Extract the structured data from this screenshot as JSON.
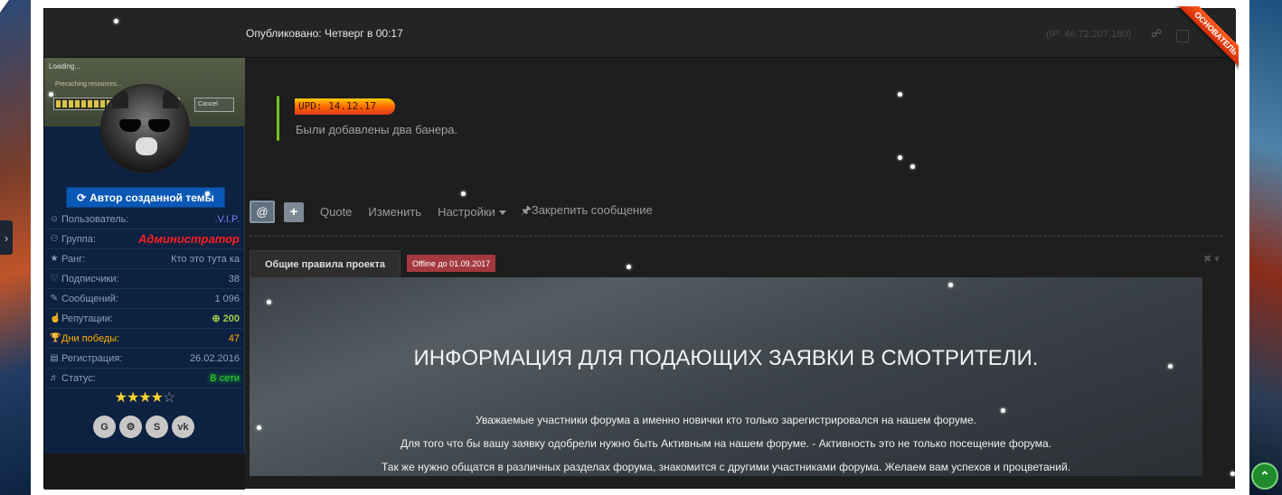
{
  "post": {
    "published": "Опубликовано: Четверг в 00:17",
    "ip": "(IP: 46.72.207.180)",
    "ribbon": "ОСНОВАТЕЛЬ"
  },
  "avatar_overlay": {
    "loading": "Loading...",
    "precaching": "Precaching resources...",
    "cancel": "Cancel"
  },
  "author": {
    "badge_label": "Автор созданной темы",
    "fields": [
      {
        "label": "Пользователь:",
        "value": ".V.I.P.",
        "icon": "user-icon"
      },
      {
        "label": "Группа:",
        "value": "Администратор",
        "icon": "group-icon"
      },
      {
        "label": "Ранг:",
        "value": "Кто это тута ка",
        "icon": "star-icon"
      },
      {
        "label": "Подписчики:",
        "value": "38",
        "icon": "heart-icon"
      },
      {
        "label": "Сообщений:",
        "value": "1 096",
        "icon": "edit-icon"
      },
      {
        "label": "Репутации:",
        "value": "200",
        "icon": "thumbs-up-icon"
      },
      {
        "label": "Дни победы:",
        "value": "47",
        "icon": "trophy-icon"
      },
      {
        "label": "Регистрация:",
        "value": "26.02.2016",
        "icon": "calendar-icon"
      },
      {
        "label": "Статус:",
        "value": "В сети",
        "icon": "bell-icon"
      }
    ],
    "rating": {
      "filled": 4,
      "total": 5
    },
    "socials": [
      "google-icon",
      "steam-icon",
      "skype-icon",
      "vk-icon"
    ]
  },
  "update": {
    "badge": "UPD: 14.12.17",
    "text": "Были добавлены два банера."
  },
  "actions": {
    "mention": "@",
    "plus": "+",
    "quote": "Quote",
    "edit": "Изменить",
    "settings": "Настройки",
    "pin": "Закрепить сообщение"
  },
  "signature": {
    "tab": "Общие правила проекта",
    "offline": "Offline до 01.09.2017",
    "heading": "ИНФОРМАЦИЯ ДЛЯ ПОДАЮЩИХ ЗАЯВКИ В СМОТРИТЕЛИ.",
    "lines": [
      "Уважаемые участники форума а именно новички кто только зарегистрировался на нашем форуме.",
      "Для того что бы вашу заявку одобрели нужно быть Активным на нашем форуме. - Активность это не только посещение форума.",
      "Так же нужно общатся в различных разделах форума, знакомится с другими участниками форума. Желаем вам успехов и процветаний."
    ]
  },
  "colors": {
    "accent_blue": "#0a58b6",
    "admin_red": "#ff1f1f",
    "online_green": "#2ad42a",
    "upd_orange": "#ff6a00"
  }
}
